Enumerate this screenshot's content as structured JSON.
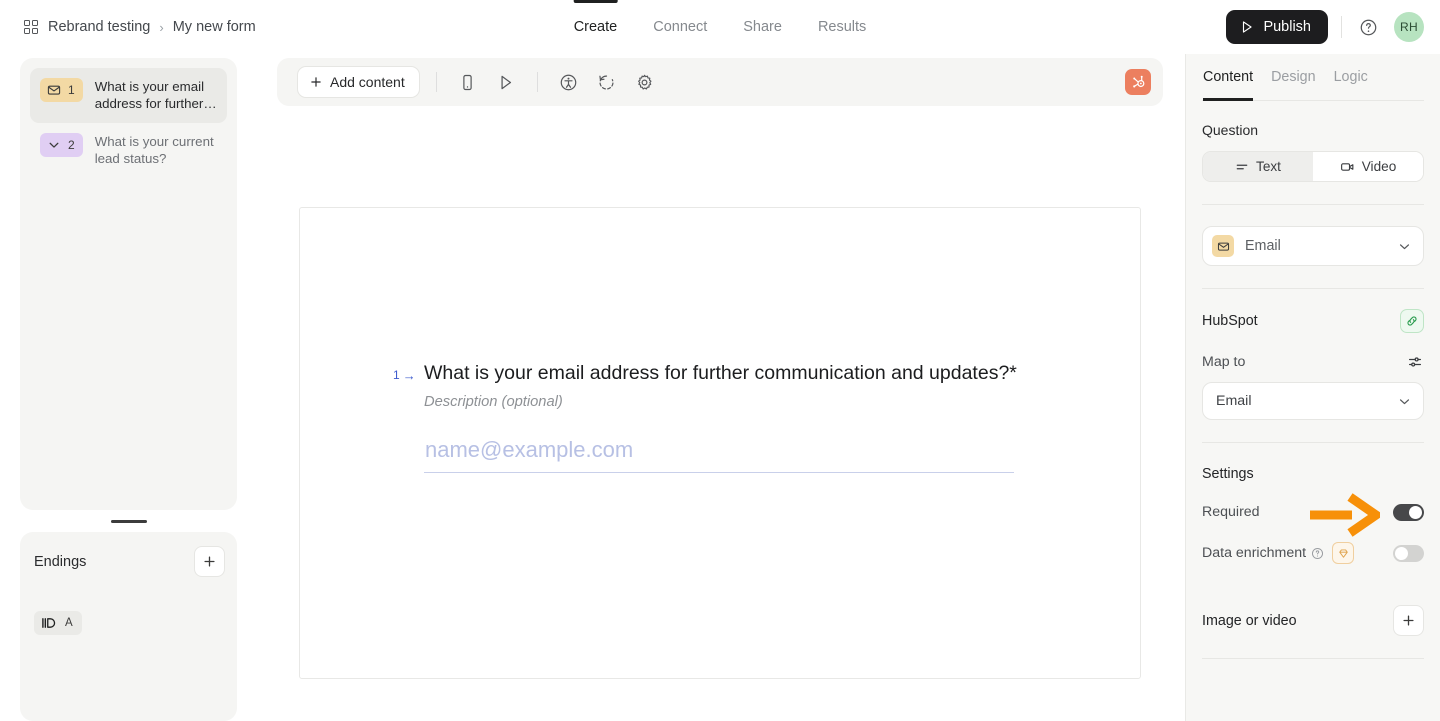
{
  "header": {
    "breadcrumb": {
      "icon": "grid-icon",
      "workspace": "Rebrand testing",
      "separator": "›",
      "current": "My new form"
    },
    "tabs": [
      {
        "label": "Create",
        "active": true
      },
      {
        "label": "Connect",
        "active": false
      },
      {
        "label": "Share",
        "active": false
      },
      {
        "label": "Results",
        "active": false
      }
    ],
    "publish_label": "Publish",
    "publish_icon": "send-icon",
    "help_icon": "help-circle-icon",
    "avatar_initials": "RH"
  },
  "sidebar": {
    "questions": [
      {
        "number": "1",
        "label": "What is your email address for further…",
        "icon": "envelope-icon",
        "badge_color": "#f3d9a4",
        "selected": true
      },
      {
        "number": "2",
        "label": "What is your current lead status?",
        "icon": "chevron-down-icon",
        "badge_color": "#e0cef3",
        "selected": false
      }
    ],
    "endings": {
      "title": "Endings",
      "add_label": "+",
      "items": [
        {
          "icon": "ending-flag-icon",
          "letter": "A"
        }
      ]
    }
  },
  "toolbar": {
    "add_content_label": "Add content",
    "add_content_icon": "plus-icon",
    "icons": [
      {
        "name": "mobile-preview-icon"
      },
      {
        "name": "play-preview-icon"
      },
      {
        "name": "accessibility-icon"
      },
      {
        "name": "restore-version-icon"
      },
      {
        "name": "gear-icon"
      }
    ],
    "integration_icon": "hubspot-logo-icon",
    "integration_color": "#ec7f5f"
  },
  "canvas": {
    "question_number": "1",
    "question_arrow": "→",
    "question_text": "What is your email address for further communication and updates?*",
    "description_placeholder": "Description (optional)",
    "input_placeholder": "name@example.com",
    "input_value": "",
    "number_color": "#3d5bce"
  },
  "right_panel": {
    "tabs": [
      {
        "label": "Content",
        "active": true
      },
      {
        "label": "Design",
        "active": false
      },
      {
        "label": "Logic",
        "active": false
      }
    ],
    "question_section": {
      "title": "Question",
      "segments": [
        {
          "label": "Text",
          "icon": "text-lines-icon",
          "active": true
        },
        {
          "label": "Video",
          "icon": "video-camera-icon",
          "active": false
        }
      ]
    },
    "field_type": {
      "value": "Email",
      "icon": "envelope-icon",
      "chevron": "chevron-down-icon"
    },
    "integration": {
      "title": "HubSpot",
      "link_icon": "link-icon",
      "map_to_label": "Map to",
      "map_to_settings_icon": "sliders-icon",
      "map_to_value": "Email",
      "map_to_chevron": "chevron-down-icon"
    },
    "settings": {
      "title": "Settings",
      "rows": [
        {
          "label": "Required",
          "toggle": "on"
        },
        {
          "label": "Data enrichment",
          "toggle": "off",
          "help_icon": "help-circle-icon",
          "badge_icon": "gem-icon"
        }
      ]
    },
    "image_or_video": {
      "label": "Image or video",
      "add_label": "+"
    }
  },
  "annotation": {
    "arrow_color": "#f79009",
    "points_to": "Required toggle"
  }
}
